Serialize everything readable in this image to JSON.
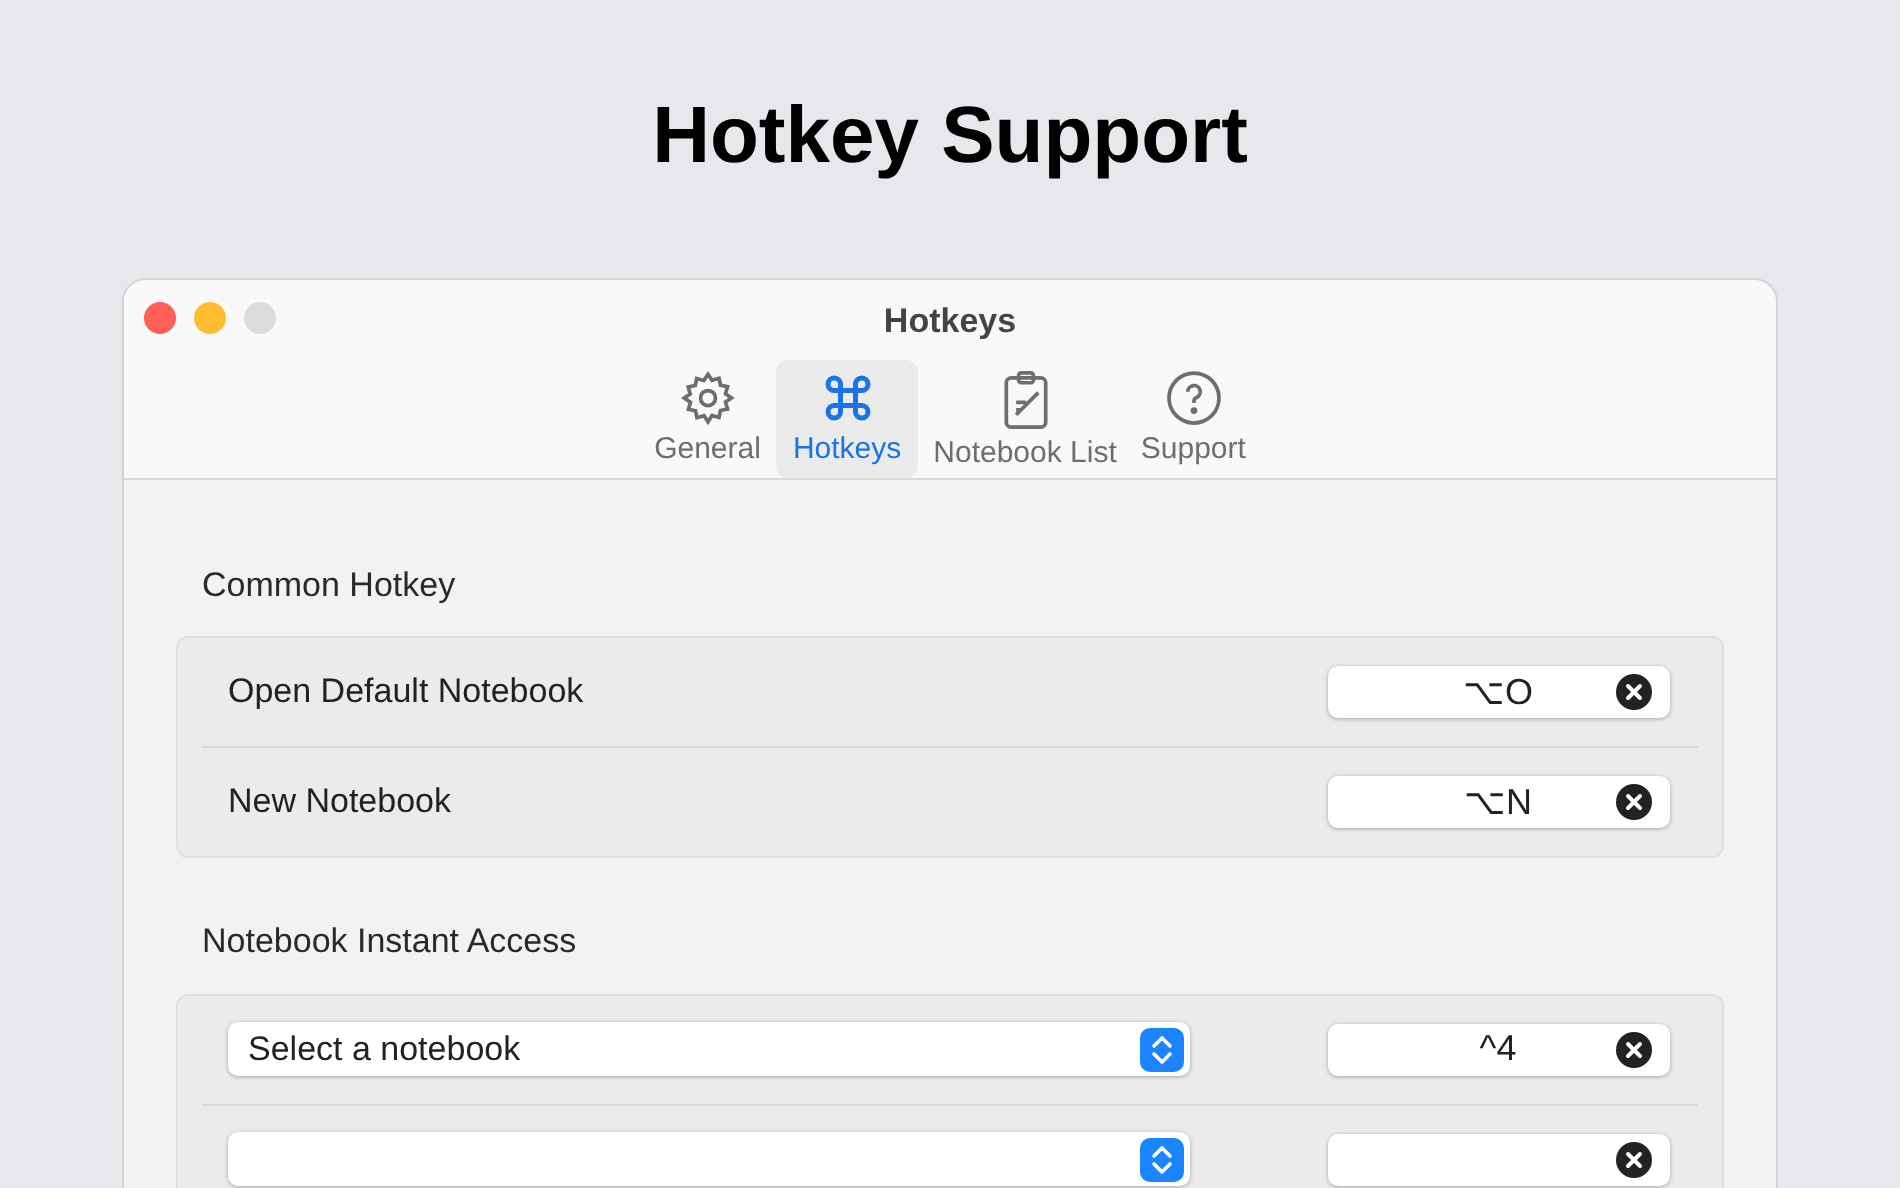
{
  "page_title": "Hotkey Support",
  "window": {
    "title": "Hotkeys"
  },
  "tabs": [
    {
      "kind": "gear",
      "label": "General",
      "selected": false
    },
    {
      "kind": "command",
      "label": "Hotkeys",
      "selected": true
    },
    {
      "kind": "clipboard",
      "label": "Notebook List",
      "selected": false
    },
    {
      "kind": "help",
      "label": "Support",
      "selected": false
    }
  ],
  "sections": [
    {
      "title": "Common Hotkey",
      "rows": [
        {
          "kind": "label",
          "label": "Open Default Notebook",
          "hotkey": "⌥O"
        },
        {
          "kind": "label",
          "label": "New Notebook",
          "hotkey": "⌥N"
        }
      ]
    },
    {
      "title": "Notebook Instant Access",
      "rows": [
        {
          "kind": "select",
          "value": "Select a notebook",
          "hotkey": "^4"
        },
        {
          "kind": "select"
        }
      ]
    }
  ]
}
